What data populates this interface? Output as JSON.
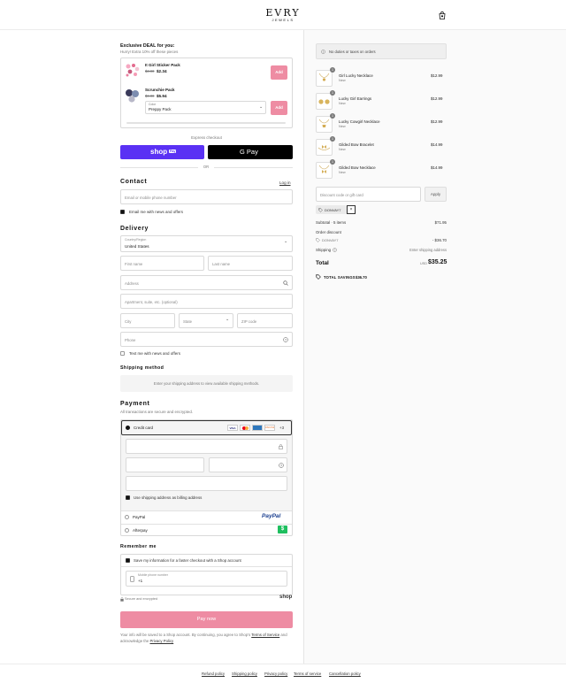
{
  "header": {
    "brand": "EVRY",
    "brand_sub": "JEWELS"
  },
  "deal": {
    "title": "Exclusive DEAL for you:",
    "subtitle": "Hurry! Extra 10% off these pieces",
    "items": [
      {
        "name": "It Girl Sticker Pack",
        "old_price": "$3.90",
        "price": "$2.34",
        "button": "Add"
      },
      {
        "name": "Scrunchie Pack",
        "old_price": "$6.00",
        "price": "$5.94",
        "select_label": "Color",
        "select_value": "Preppy Pack",
        "button": "Add"
      }
    ]
  },
  "express": {
    "label": "Express checkout",
    "shop_pay": "shop",
    "shop_pay_badge": "Pay",
    "gpay": "G Pay",
    "or": "OR"
  },
  "contact": {
    "title": "Contact",
    "login": "Log in",
    "email_placeholder": "Email or mobile phone number",
    "news_label": "Email me with news and offers"
  },
  "delivery": {
    "title": "Delivery",
    "country_label": "Country/Region",
    "country_value": "United States",
    "first_name": "First name",
    "last_name": "Last name",
    "address": "Address",
    "apartment": "Apartment, suite, etc. (optional)",
    "city": "City",
    "state": "State",
    "zip": "ZIP code",
    "phone": "Phone",
    "text_label": "Text me with news and offers"
  },
  "shipping_method": {
    "title": "Shipping method",
    "note": "Enter your shipping address to view available shipping methods."
  },
  "payment": {
    "title": "Payment",
    "subtitle": "All transactions are secure and encrypted.",
    "credit_card": "Credit card",
    "card_badges": [
      "VISA",
      "MC",
      "AMEX",
      "DISCOVER"
    ],
    "more_cards": "+3",
    "billing_label": "Use shipping address as billing address",
    "paypal": "PayPal",
    "paypal_logo": "PayPal",
    "afterpay": "Afterpay"
  },
  "remember": {
    "title": "Remember me",
    "save_label": "Save my information for a faster checkout with a Shop account",
    "mobile_label": "Mobile phone number",
    "mobile_value": "+1",
    "secure": "Secure and encrypted",
    "shop_logo": "shop"
  },
  "pay_now": "Pay now",
  "terms": {
    "text": "Your info will be saved to a Shop account. By continuing, you agree to Shop's",
    "terms_link": "Terms of Service",
    "and": "and acknowledge the",
    "privacy_link": "Privacy Policy"
  },
  "summary": {
    "notice": "No duties or taxes on orders",
    "products": [
      {
        "qty": "1",
        "name": "Girl Lucky Necklace",
        "tag": "New",
        "price": "$12.99"
      },
      {
        "qty": "1",
        "name": "Lucky Girl Earrings",
        "tag": "New",
        "price": "$12.99"
      },
      {
        "qty": "1",
        "name": "Lucky Cowgirl Necklace",
        "tag": "New",
        "price": "$12.99"
      },
      {
        "qty": "1",
        "name": "Gilded Bow Bracelet",
        "tag": "New",
        "price": "$14.99"
      },
      {
        "qty": "1",
        "name": "Gilded Bow Necklace",
        "tag": "New",
        "price": "$14.99"
      }
    ],
    "discount_placeholder": "Discount code or gift card",
    "apply": "Apply",
    "code_chip": "DONVAY7",
    "subtotal_label": "Subtotal · 5 items",
    "subtotal_value": "$71.95",
    "order_discount": "Order discount",
    "discount_code": "DONVAY7",
    "discount_value": "- $36.70",
    "shipping_label": "Shipping",
    "shipping_value": "Enter shipping address",
    "total_label": "Total",
    "currency": "USD",
    "total_value": "$35.25",
    "savings_label": "TOTAL SAVINGS",
    "savings_value": "$36.70"
  },
  "footer": {
    "links": [
      "Refund policy",
      "Shipping policy",
      "Privacy policy",
      "Terms of service",
      "Cancellation policy"
    ]
  }
}
